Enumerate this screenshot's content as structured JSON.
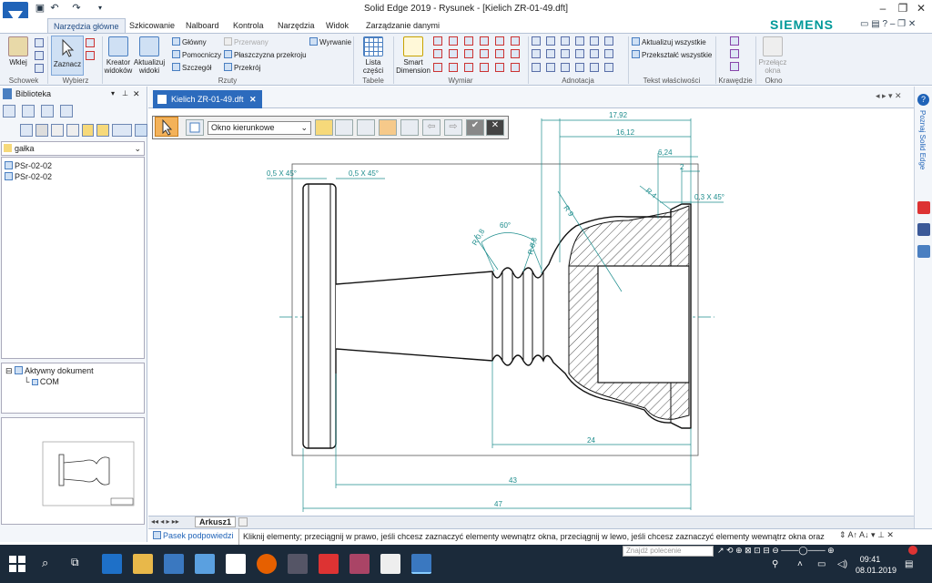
{
  "window": {
    "title": "Solid Edge 2019 - Rysunek - [Kielich ZR-01-49.dft]",
    "brand": "SIEMENS",
    "brand_color": "#009999",
    "accent": "#2c6bbd"
  },
  "ribbon": {
    "tabs": [
      "Narzędzia główne",
      "Szkicowanie",
      "Nalboard",
      "Kontrola",
      "Narzędzia",
      "Widok",
      "Zarządzanie danymi"
    ],
    "active_tab": "Narzędzia główne",
    "groups": {
      "schowek": {
        "label": "Schowek",
        "wklej": "Wklej"
      },
      "wybierz": {
        "label": "Wybierz",
        "zaznacz": "Zaznacz"
      },
      "rzuty": {
        "label": "Rzuty",
        "kreator": "Kreator widoków",
        "aktualizuj": "Aktualizuj widoki",
        "glowny": "Główny",
        "pomocniczy": "Pomocniczy",
        "szczegol": "Szczegół",
        "przerwany": "Przerwany",
        "plaszczyzna": "Płaszczyzna przekroju",
        "przekroj": "Przekrój",
        "wyrwanie": "Wyrwanie"
      },
      "tabele": {
        "label": "Tabele",
        "lista": "Lista części"
      },
      "wymiar": {
        "label": "Wymiar",
        "smart": "Smart Dimension"
      },
      "adnotacja": {
        "label": "Adnotacja"
      },
      "tekst": {
        "label": "Tekst właściwości",
        "aktualizuj_wszystkie": "Aktualizuj wszystkie",
        "przeksztalc": "Przekształć wszystkie"
      },
      "krawedzie": {
        "label": "Krawędzie"
      },
      "okno": {
        "label": "Okno",
        "przelacz": "Przełącz okna"
      }
    }
  },
  "library": {
    "title": "Biblioteka",
    "folder": "gałka",
    "files": [
      "PSr-02-02",
      "PSr-02-02"
    ],
    "tree_root": "Aktywny dokument",
    "tree_child": "COM"
  },
  "document": {
    "tab": "Kielich ZR-01-49.dft",
    "cmd_dropdown": "Okno kierunkowe"
  },
  "drawing": {
    "dims": {
      "d1792": "17,92",
      "d1612": "16,12",
      "d624": "6,24",
      "d2": "2",
      "c05a": "0,5 X 45°",
      "c05b": "0,5 X 45°",
      "c03": "0,3 X 45°",
      "ang60": "60°",
      "r08": "R 0,8",
      "r08b": "R 0,8",
      "r9": "R 9",
      "r4": "R 4",
      "d24": "24",
      "d43": "43",
      "d47": "47"
    }
  },
  "sheets": {
    "active": "Arkusz1"
  },
  "status": {
    "hint_label": "Pasek podpowiedzi",
    "hint_text": "Kliknij elementy; przeciągnij w prawo, jeśli chcesz zaznaczyć elementy wewnątrz okna, przeciągnij w lewo, jeśli chcesz zaznaczyć elementy wewnątrz okna oraz",
    "search_placeholder": "Znajdź polecenie"
  },
  "side_strip": {
    "label": "Poznaj Solid Edge"
  },
  "taskbar": {
    "time": "09:41",
    "date": "08.01.2019"
  }
}
